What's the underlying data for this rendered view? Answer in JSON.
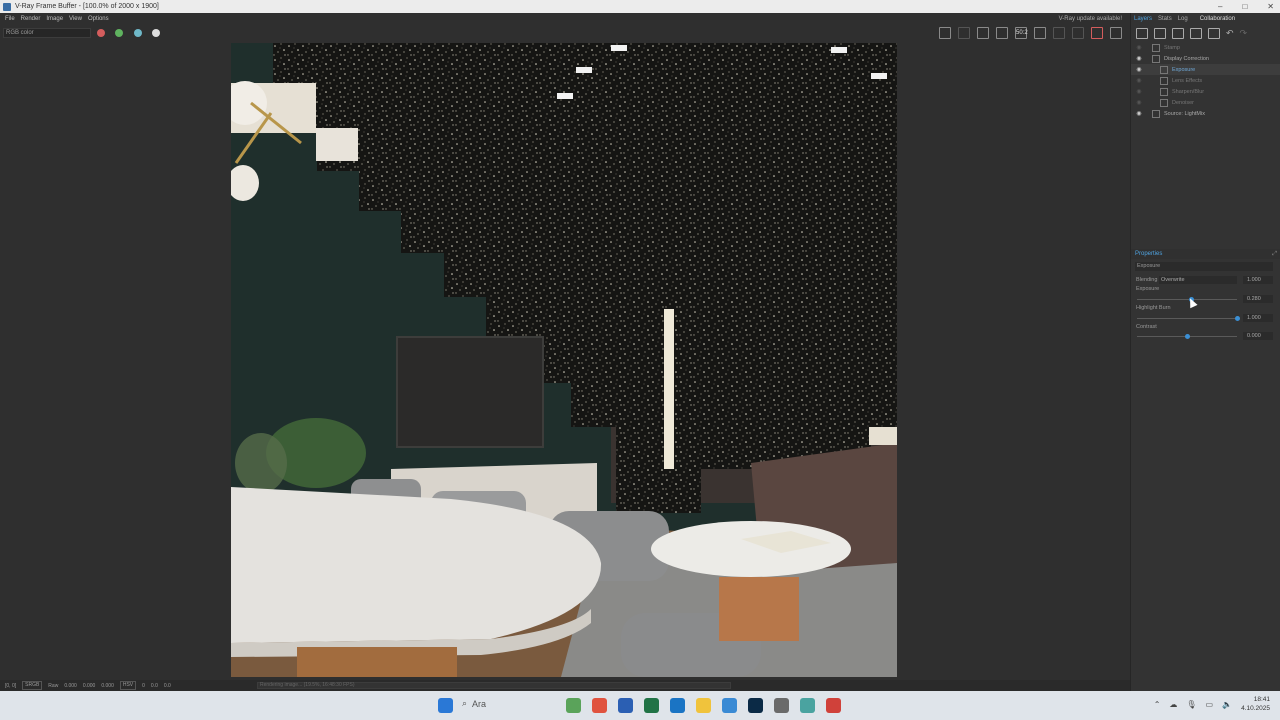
{
  "window": {
    "title": "V-Ray Frame Buffer - [100.0% of 2000 x 1900]",
    "controls": [
      "–",
      "□",
      "✕"
    ]
  },
  "menu": {
    "items": [
      "File",
      "Render",
      "Image",
      "View",
      "Options"
    ],
    "update_notice": "V-Ray update available!"
  },
  "toolbar": {
    "channel": "RGB color",
    "dots": [
      {
        "name": "red-channel",
        "color": "#d45d5d"
      },
      {
        "name": "green-channel",
        "color": "#5fb35f"
      },
      {
        "name": "blue-channel",
        "color": "#6fb8c8"
      }
    ],
    "zoom_badge": "50:2"
  },
  "panel": {
    "tabs": [
      "Layers",
      "Stats",
      "Log",
      "Collaboration"
    ],
    "layers": [
      {
        "label": "Stamp",
        "visible": false,
        "indent": 1,
        "selected": false
      },
      {
        "label": "Display Correction",
        "visible": true,
        "indent": 1,
        "selected": false
      },
      {
        "label": "Exposure",
        "visible": true,
        "indent": 2,
        "selected": true
      },
      {
        "label": "Lens Effects",
        "visible": false,
        "indent": 2,
        "selected": false
      },
      {
        "label": "Sharpen/Blur",
        "visible": false,
        "indent": 2,
        "selected": false
      },
      {
        "label": "Denoiser",
        "visible": false,
        "indent": 2,
        "selected": false
      },
      {
        "label": "Source: LightMix",
        "visible": true,
        "indent": 1,
        "selected": false
      }
    ],
    "properties": {
      "header": "Properties",
      "layer_name": "Exposure",
      "blending_label": "Blending",
      "blending_value": "Overwrite",
      "blending_amount": "1.000",
      "exposure_label": "Exposure",
      "exposure_value": "0.280",
      "exposure_level": 0.54,
      "highlight_label": "Highlight Burn",
      "highlight_value": "1.000",
      "highlight_level": 1.0,
      "contrast_label": "Contrast",
      "contrast_value": "0.000",
      "contrast_level": 0.5
    }
  },
  "status": {
    "coords": "[0, 0]",
    "mode": "SRGB",
    "raw_label": "Raw",
    "raw_values": [
      "0.000",
      "0.000",
      "0.000"
    ],
    "hsv_label": "HSV",
    "hsv_values": [
      "0",
      "0.0",
      "0.0"
    ],
    "progress_text": "Rendering image... (19.5%, 16:48:30 FPS)"
  },
  "taskbar": {
    "search_placeholder": "Ara",
    "time": "18:41",
    "date": "4.10.2025",
    "apps": [
      {
        "name": "photos-app-icon",
        "color": "#5aa35a"
      },
      {
        "name": "chrome-app-icon",
        "color": "#e0533f"
      },
      {
        "name": "word-app-icon",
        "color": "#2b5fb3"
      },
      {
        "name": "excel-app-icon",
        "color": "#217346"
      },
      {
        "name": "outlook-app-icon",
        "color": "#1a74c4"
      },
      {
        "name": "file-explorer-app-icon",
        "color": "#f0c33c"
      },
      {
        "name": "snipping-tool-app-icon",
        "color": "#3a8ad4"
      },
      {
        "name": "photoshop-app-icon",
        "color": "#0b2a46"
      },
      {
        "name": "calculator-app-icon",
        "color": "#6a6a6a"
      },
      {
        "name": "vray-app-icon",
        "color": "#4aa3a0"
      },
      {
        "name": "sketchup-app-icon",
        "color": "#d0413a"
      }
    ]
  }
}
